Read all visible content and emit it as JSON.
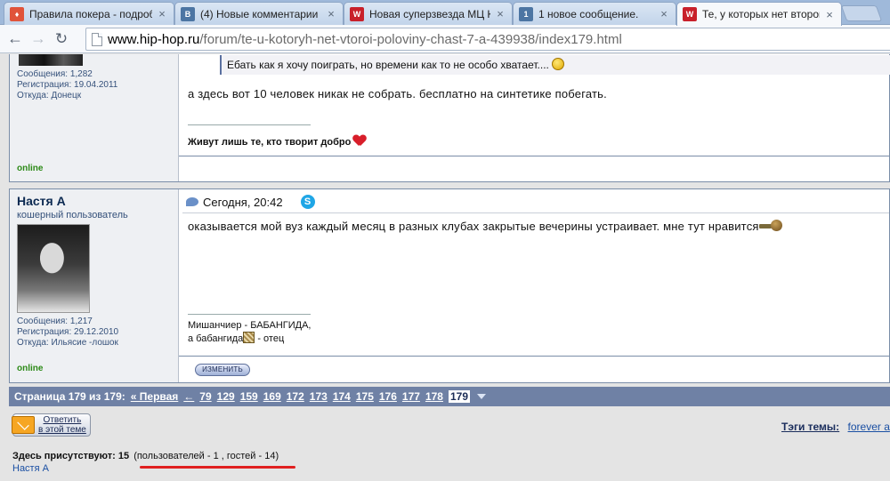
{
  "browser": {
    "tabs": [
      {
        "title": "Правила покера - подроб",
        "favicon": "poker-icon",
        "color": "#e0533a",
        "active": false
      },
      {
        "title": "(4) Новые комментарии",
        "favicon": "vk-icon",
        "color": "#4c75a3",
        "active": false
      },
      {
        "title": "Новая суперзвезда МЦ К/",
        "favicon": "hiphop-icon",
        "color": "#c8202a",
        "active": false
      },
      {
        "title": "1 новое сообщение.",
        "favicon": "vk-icon",
        "color": "#4c75a3",
        "active": false
      },
      {
        "title": "Те, у которых нет второй",
        "favicon": "hiphop-icon",
        "color": "#c8202a",
        "active": true
      }
    ],
    "url_host": "www.hip-hop.ru",
    "url_path": "/forum/te-u-kotoryh-net-vtoroi-poloviny-chast-7-a-439938/index179.html"
  },
  "post1": {
    "stats": [
      "Сообщения: 1,282",
      "Регистрация: 19.04.2011",
      "Откуда: Донецк"
    ],
    "status": "online",
    "quote": "Ебать как я хочу поиграть, но времени как то не особо хватает....",
    "text": "а здесь вот 10 человек никак не собрать. бесплатно на синтетике побегать.",
    "signature": "Живут лишь те, кто творит добро"
  },
  "post2": {
    "username": "Настя А",
    "user_title": "кошерный пользователь",
    "stats": [
      "Сообщения: 1,217",
      "Регистрация: 29.12.2010",
      "Откуда: Ильясие -лошок"
    ],
    "status": "online",
    "date": "Сегодня, 20:42",
    "text": "оказывается мой вуз каждый месяц в разных клубах закрытые вечерины устраивает. мне тут нравится",
    "signature_line1": "Мишанчиер - БАБАНГИДА,",
    "signature_line2_a": "а бабангида",
    "signature_line2_b": " - отец",
    "edit_label": "ИЗМЕНИТЬ"
  },
  "pagination": {
    "label": "Страница 179 из 179:",
    "first": "« Первая",
    "prev": "←",
    "pages": [
      "79",
      "129",
      "159",
      "169",
      "172",
      "173",
      "174",
      "175",
      "176",
      "177",
      "178"
    ],
    "current": "179"
  },
  "footer": {
    "reply_line1": "Ответить",
    "reply_line2": "в этой теме",
    "tags_label": "Тэги темы:",
    "tags_value": "forever a",
    "present_label": "Здесь присутствуют:",
    "present_count": "15",
    "present_detail": "(пользователей - 1 , гостей - 14)",
    "present_user": "Настя А"
  }
}
